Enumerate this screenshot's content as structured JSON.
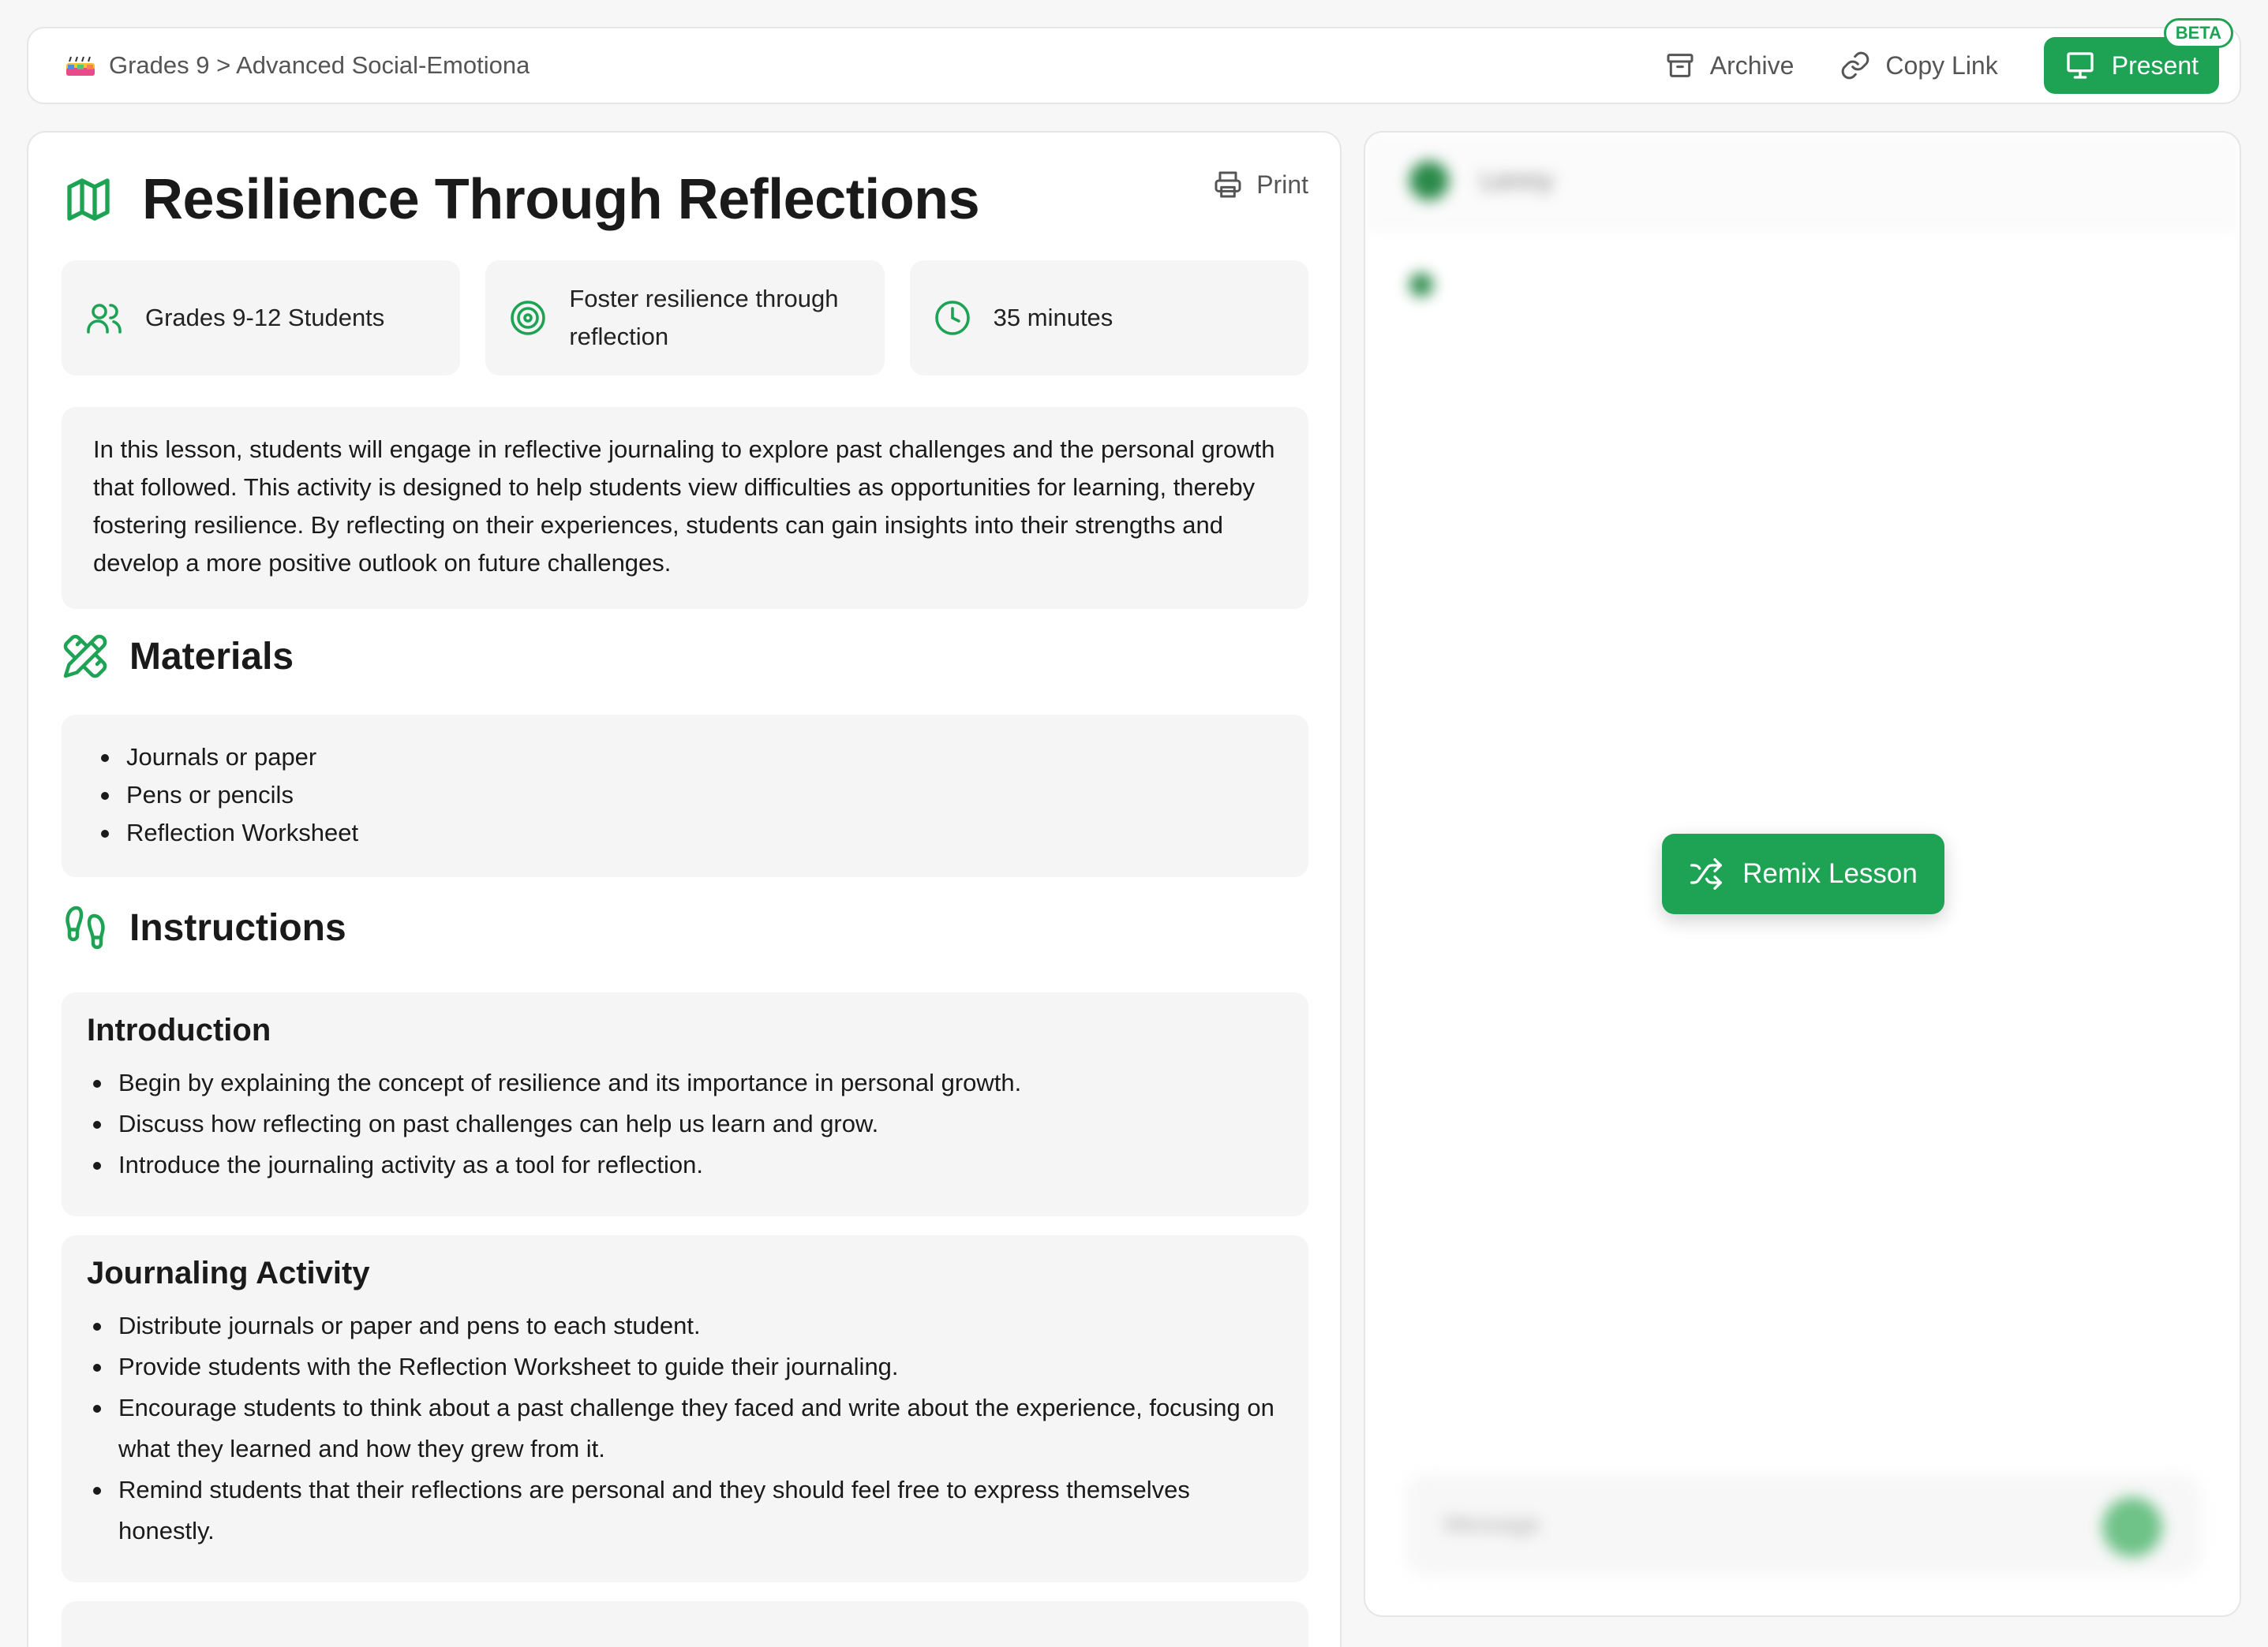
{
  "topbar": {
    "breadcrumb": "Grades 9 > Advanced Social-Emotiona",
    "archive_label": "Archive",
    "copy_link_label": "Copy Link",
    "present_label": "Present",
    "beta_badge": "BETA"
  },
  "lesson": {
    "title": "Resilience Through Reflections",
    "print_label": "Print",
    "meta": {
      "audience": "Grades 9-12 Students",
      "objective_line1": "Foster resilience through",
      "objective_line2": "reflection",
      "duration": "35 minutes"
    },
    "description": "In this lesson, students will engage in reflective journaling to explore past challenges and the personal growth that followed. This activity is designed to help students view difficulties as opportunities for learning, thereby fostering resilience. By reflecting on their experiences, students can gain insights into their strengths and develop a more positive outlook on future challenges.",
    "materials_heading": "Materials",
    "materials": [
      "Journals or paper",
      "Pens or pencils",
      "Reflection Worksheet"
    ],
    "instructions_heading": "Instructions",
    "sections": [
      {
        "title": "Introduction",
        "items": [
          "Begin by explaining the concept of resilience and its importance in personal growth.",
          "Discuss how reflecting on past challenges can help us learn and grow.",
          "Introduce the journaling activity as a tool for reflection."
        ]
      },
      {
        "title": "Journaling Activity",
        "items": [
          "Distribute journals or paper and pens to each student.",
          "Provide students with the Reflection Worksheet to guide their journaling.",
          "Encourage students to think about a past challenge they faced and write about the experience, focusing on what they learned and how they grew from it.",
          "Remind students that their reflections are personal and they should feel free to express themselves honestly."
        ]
      }
    ]
  },
  "chat": {
    "assistant_name": "Lenny",
    "input_placeholder": "Message",
    "remix_label": "Remix Lesson"
  },
  "colors": {
    "accent": "#1ea355",
    "card_bg": "#f5f5f5",
    "page_bg": "#f7f7f7"
  }
}
